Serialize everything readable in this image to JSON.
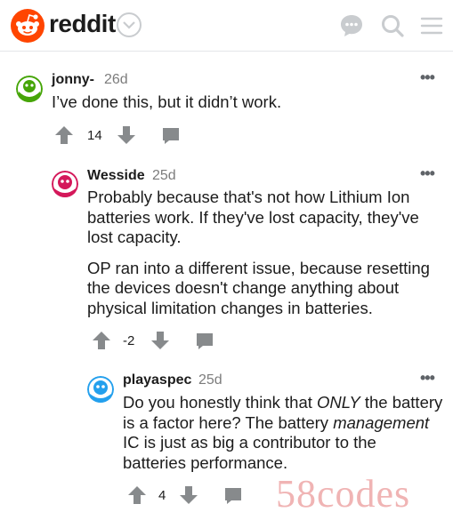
{
  "header": {
    "logo_text": "reddit"
  },
  "comments": [
    {
      "username": "jonny-",
      "age": "26d",
      "body": [
        "I’ve done this, but it didn’t work."
      ],
      "score": "14"
    },
    {
      "username": "Wesside",
      "age": "25d",
      "body": [
        "Probably because that's not how Lithium Ion batteries work. If they've lost capacity, they've lost capacity.",
        "OP ran into a different issue, because resetting the devices doesn't change anything about physical limitation changes in batteries."
      ],
      "score": "-2"
    },
    {
      "username": "playaspec",
      "age": "25d",
      "body_parts": [
        "Do you honestly think that ",
        "ONLY",
        " the battery is a factor here? The battery ",
        "management",
        " IC is just as big a contributor to the batteries performance."
      ],
      "score": "4"
    }
  ],
  "watermark": "58codes",
  "colors": {
    "brand": "#ff4500",
    "icon_gray": "#c9cccf",
    "action_gray": "#878a8c"
  },
  "icons": [
    "reddit-logo-icon",
    "chevron-down-icon",
    "chat-icon",
    "search-icon",
    "menu-icon",
    "upvote-icon",
    "downvote-icon",
    "reply-icon",
    "more-options-icon"
  ]
}
